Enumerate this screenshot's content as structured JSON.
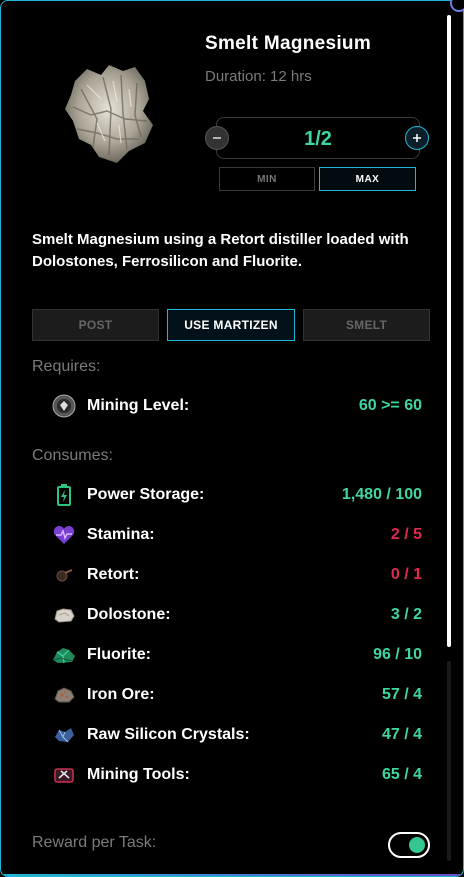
{
  "item": {
    "title": "Smelt Magnesium",
    "duration": "Duration: 12 hrs",
    "image_icon": "magnesium-crystal-icon"
  },
  "stepper": {
    "value": "1/2",
    "minus_icon": "minus-icon",
    "plus_icon": "plus-icon",
    "min_label": "MIN",
    "max_label": "MAX"
  },
  "description": "Smelt Magnesium using a Retort distiller loaded with Dolostones, Ferrosilicon and Fluorite.",
  "actions": {
    "post": "POST",
    "use_martizen": "USE MARTIZEN",
    "smelt": "SMELT"
  },
  "requires": {
    "label": "Requires:",
    "items": [
      {
        "name": "Mining Level:",
        "value": "60 >= 60",
        "status": "ok",
        "icon": "mining-level-badge-icon"
      }
    ]
  },
  "consumes": {
    "label": "Consumes:",
    "items": [
      {
        "name": "Power Storage:",
        "value": "1,480 / 100",
        "status": "ok",
        "icon": "battery-icon"
      },
      {
        "name": "Stamina:",
        "value": "2 / 5",
        "status": "bad",
        "icon": "heart-pulse-icon"
      },
      {
        "name": "Retort:",
        "value": "0 / 1",
        "status": "bad",
        "icon": "retort-icon"
      },
      {
        "name": "Dolostone:",
        "value": "3 / 2",
        "status": "ok",
        "icon": "dolostone-rock-icon"
      },
      {
        "name": "Fluorite:",
        "value": "96 / 10",
        "status": "ok",
        "icon": "fluorite-crystal-icon"
      },
      {
        "name": "Iron Ore:",
        "value": "57 / 4",
        "status": "ok",
        "icon": "iron-ore-icon"
      },
      {
        "name": "Raw Silicon Crystals:",
        "value": "47 / 4",
        "status": "ok",
        "icon": "silicon-crystal-icon"
      },
      {
        "name": "Mining Tools:",
        "value": "65 / 4",
        "status": "ok",
        "icon": "mining-tools-icon"
      }
    ]
  },
  "reward": {
    "label": "Reward per Task:",
    "toggle_on": true
  },
  "colors": {
    "accent": "#1fb6d6",
    "ok": "#3fd6a0",
    "bad": "#e0294f",
    "muted": "#7b7b7b"
  }
}
